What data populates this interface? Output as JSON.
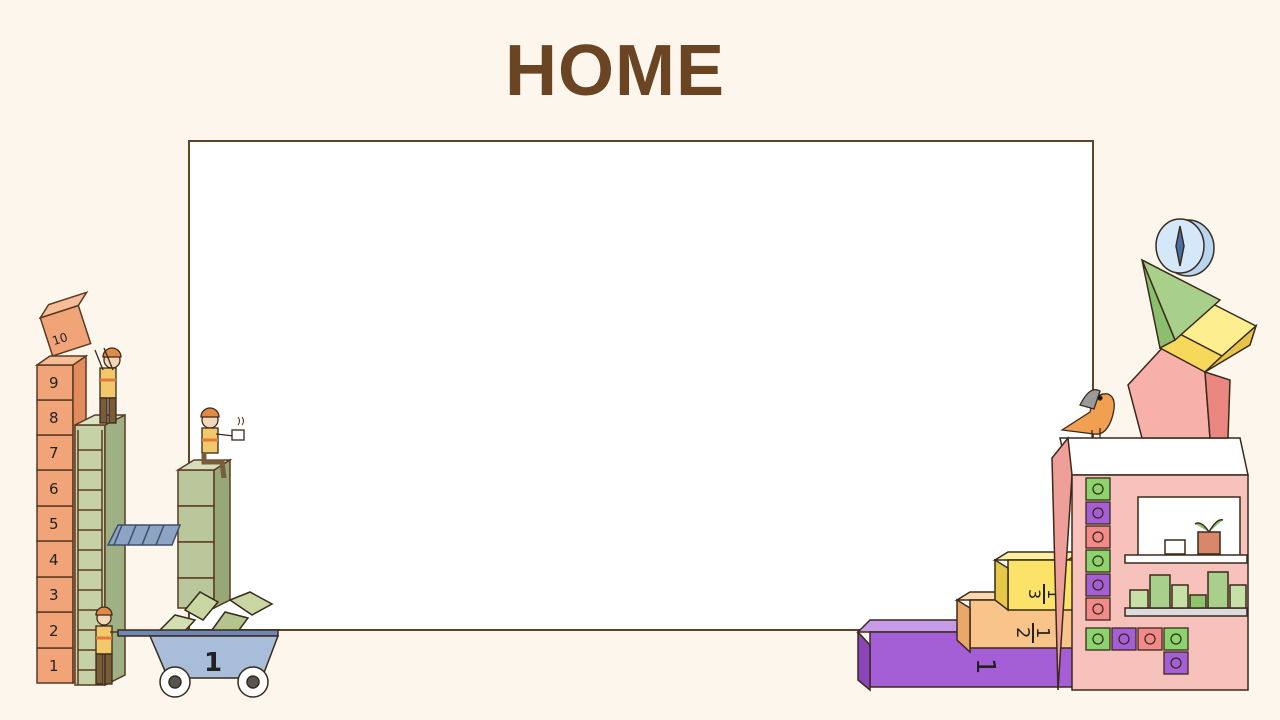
{
  "page": {
    "title": "HOME"
  },
  "left_illustration": {
    "block_numbers": [
      "1",
      "2",
      "3",
      "4",
      "5",
      "6",
      "7",
      "8",
      "9",
      "10"
    ],
    "cart_label": "1"
  },
  "right_illustration": {
    "step_labels": [
      {
        "num": "1",
        "den": "3"
      },
      {
        "num": "1",
        "den": "2"
      },
      {
        "num": "1",
        "den": ""
      }
    ]
  },
  "colors": {
    "background": "#fdf6ec",
    "title": "#6b4423",
    "board_border": "#5e4428",
    "block_orange": "#f2a479",
    "block_green": "#b9c79a",
    "step_yellow": "#fbe36a",
    "step_peach": "#f9c48a",
    "step_purple": "#a55fd6",
    "house_pink": "#f7c2bc"
  }
}
